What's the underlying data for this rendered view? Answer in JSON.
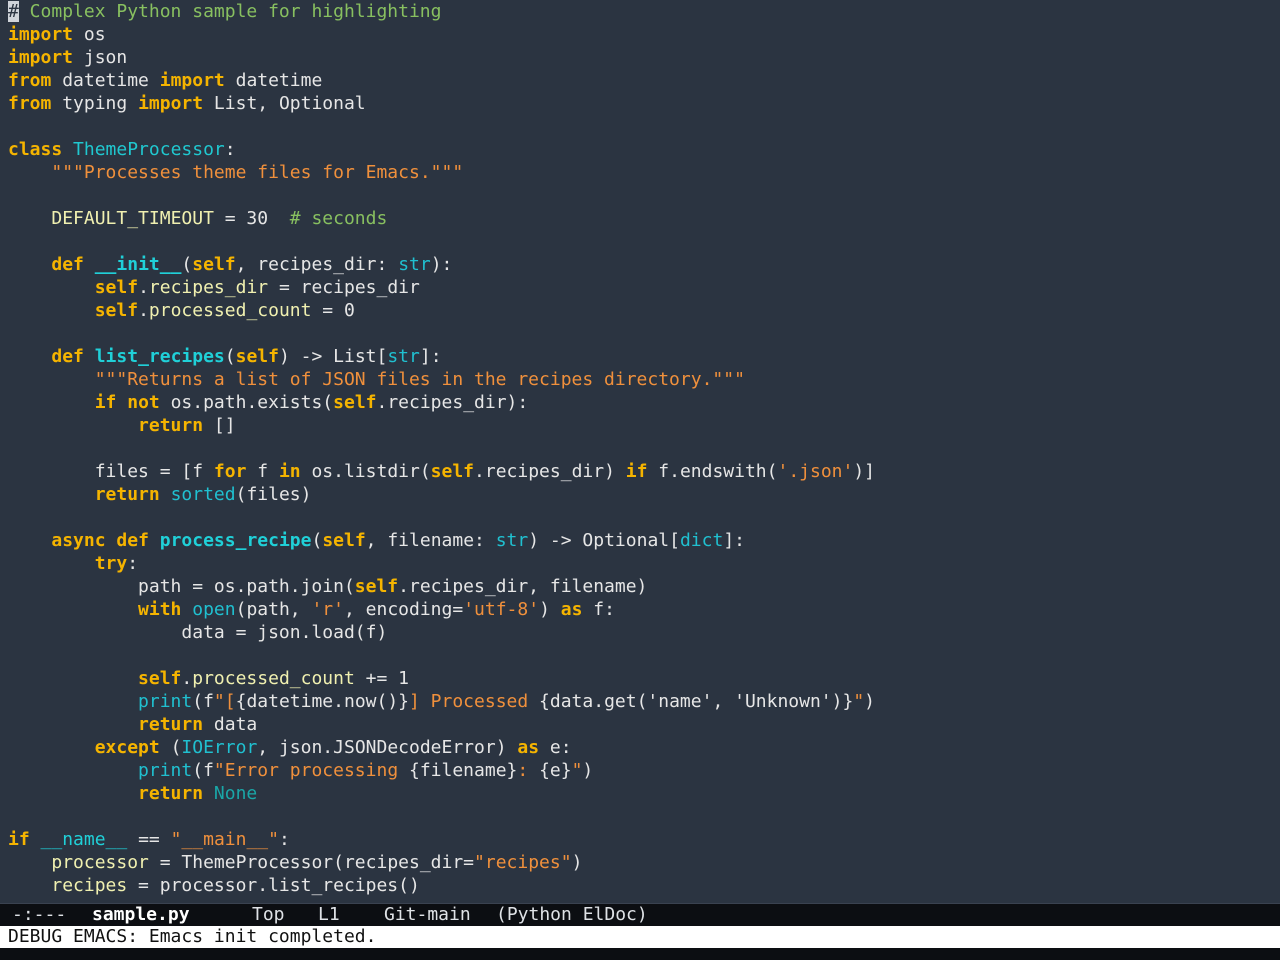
{
  "editor": {
    "lines": [
      [
        [
          "cursor",
          "#"
        ],
        [
          "cmt",
          " Complex Python sample for highlighting"
        ]
      ],
      [
        [
          "kw",
          "import"
        ],
        [
          "txt",
          " os"
        ]
      ],
      [
        [
          "kw",
          "import"
        ],
        [
          "txt",
          " json"
        ]
      ],
      [
        [
          "kw",
          "from"
        ],
        [
          "txt",
          " datetime "
        ],
        [
          "kw",
          "import"
        ],
        [
          "txt",
          " datetime"
        ]
      ],
      [
        [
          "kw",
          "from"
        ],
        [
          "txt",
          " typing "
        ],
        [
          "kw",
          "import"
        ],
        [
          "txt",
          " List, Optional"
        ]
      ],
      [],
      [
        [
          "kw",
          "class"
        ],
        [
          "txt",
          " "
        ],
        [
          "cls",
          "ThemeProcessor"
        ],
        [
          "txt",
          ":"
        ]
      ],
      [
        [
          "txt",
          "    "
        ],
        [
          "str",
          "\"\"\"Processes theme files for Emacs.\"\"\""
        ]
      ],
      [],
      [
        [
          "txt",
          "    "
        ],
        [
          "cst",
          "DEFAULT_TIMEOUT"
        ],
        [
          "txt",
          " = 30  "
        ],
        [
          "cmt",
          "# seconds"
        ]
      ],
      [],
      [
        [
          "txt",
          "    "
        ],
        [
          "kw",
          "def"
        ],
        [
          "txt",
          " "
        ],
        [
          "def",
          "__init__"
        ],
        [
          "txt",
          "("
        ],
        [
          "slf",
          "self"
        ],
        [
          "txt",
          ", recipes_dir: "
        ],
        [
          "blt",
          "str"
        ],
        [
          "txt",
          "):"
        ]
      ],
      [
        [
          "txt",
          "        "
        ],
        [
          "slf",
          "self"
        ],
        [
          "txt",
          "."
        ],
        [
          "prp",
          "recipes_dir"
        ],
        [
          "txt",
          " = recipes_dir"
        ]
      ],
      [
        [
          "txt",
          "        "
        ],
        [
          "slf",
          "self"
        ],
        [
          "txt",
          "."
        ],
        [
          "prp",
          "processed_count"
        ],
        [
          "txt",
          " = 0"
        ]
      ],
      [],
      [
        [
          "txt",
          "    "
        ],
        [
          "kw",
          "def"
        ],
        [
          "txt",
          " "
        ],
        [
          "def",
          "list_recipes"
        ],
        [
          "txt",
          "("
        ],
        [
          "slf",
          "self"
        ],
        [
          "txt",
          ") -> List["
        ],
        [
          "blt",
          "str"
        ],
        [
          "txt",
          "]:"
        ]
      ],
      [
        [
          "txt",
          "        "
        ],
        [
          "str",
          "\"\"\"Returns a list of JSON files in the recipes directory.\"\"\""
        ]
      ],
      [
        [
          "txt",
          "        "
        ],
        [
          "kw",
          "if"
        ],
        [
          "txt",
          " "
        ],
        [
          "kw",
          "not"
        ],
        [
          "txt",
          " os.path.exists("
        ],
        [
          "slf",
          "self"
        ],
        [
          "txt",
          ".recipes_dir):"
        ]
      ],
      [
        [
          "txt",
          "            "
        ],
        [
          "kw",
          "return"
        ],
        [
          "txt",
          " []"
        ]
      ],
      [],
      [
        [
          "txt",
          "        files = [f "
        ],
        [
          "kw",
          "for"
        ],
        [
          "txt",
          " f "
        ],
        [
          "kw",
          "in"
        ],
        [
          "txt",
          " os.listdir("
        ],
        [
          "slf",
          "self"
        ],
        [
          "txt",
          ".recipes_dir) "
        ],
        [
          "kw",
          "if"
        ],
        [
          "txt",
          " f.endswith("
        ],
        [
          "str",
          "'.json'"
        ],
        [
          "txt",
          ")]"
        ]
      ],
      [
        [
          "txt",
          "        "
        ],
        [
          "kw",
          "return"
        ],
        [
          "txt",
          " "
        ],
        [
          "blt",
          "sorted"
        ],
        [
          "txt",
          "(files)"
        ]
      ],
      [],
      [
        [
          "txt",
          "    "
        ],
        [
          "kw",
          "async"
        ],
        [
          "txt",
          " "
        ],
        [
          "kw",
          "def"
        ],
        [
          "txt",
          " "
        ],
        [
          "def",
          "process_recipe"
        ],
        [
          "txt",
          "("
        ],
        [
          "slf",
          "self"
        ],
        [
          "txt",
          ", filename: "
        ],
        [
          "blt",
          "str"
        ],
        [
          "txt",
          ") -> Optional["
        ],
        [
          "blt",
          "dict"
        ],
        [
          "txt",
          "]:"
        ]
      ],
      [
        [
          "txt",
          "        "
        ],
        [
          "kw",
          "try"
        ],
        [
          "txt",
          ":"
        ]
      ],
      [
        [
          "txt",
          "            path = os.path.join("
        ],
        [
          "slf",
          "self"
        ],
        [
          "txt",
          ".recipes_dir, filename)"
        ]
      ],
      [
        [
          "txt",
          "            "
        ],
        [
          "kw",
          "with"
        ],
        [
          "txt",
          " "
        ],
        [
          "blt",
          "open"
        ],
        [
          "txt",
          "(path, "
        ],
        [
          "str",
          "'r'"
        ],
        [
          "txt",
          ", encoding="
        ],
        [
          "str",
          "'utf-8'"
        ],
        [
          "txt",
          ") "
        ],
        [
          "kw",
          "as"
        ],
        [
          "txt",
          " f:"
        ]
      ],
      [
        [
          "txt",
          "                data = json.load(f)"
        ]
      ],
      [],
      [
        [
          "txt",
          "            "
        ],
        [
          "slf",
          "self"
        ],
        [
          "txt",
          "."
        ],
        [
          "prp",
          "processed_count"
        ],
        [
          "txt",
          " += 1"
        ]
      ],
      [
        [
          "txt",
          "            "
        ],
        [
          "blt",
          "print"
        ],
        [
          "txt",
          "(f"
        ],
        [
          "str",
          "\"["
        ],
        [
          "txt",
          "{datetime.now()}"
        ],
        [
          "str",
          "] Processed "
        ],
        [
          "txt",
          "{data.get('name', 'Unknown')}"
        ],
        [
          "str",
          "\""
        ],
        [
          "txt",
          ")"
        ]
      ],
      [
        [
          "txt",
          "            "
        ],
        [
          "kw",
          "return"
        ],
        [
          "txt",
          " data"
        ]
      ],
      [
        [
          "txt",
          "        "
        ],
        [
          "kw",
          "except"
        ],
        [
          "txt",
          " ("
        ],
        [
          "blt",
          "IOError"
        ],
        [
          "txt",
          ", json.JSONDecodeError) "
        ],
        [
          "kw",
          "as"
        ],
        [
          "txt",
          " e:"
        ]
      ],
      [
        [
          "txt",
          "            "
        ],
        [
          "blt",
          "print"
        ],
        [
          "txt",
          "(f"
        ],
        [
          "str",
          "\"Error processing "
        ],
        [
          "txt",
          "{filename}"
        ],
        [
          "str",
          ": "
        ],
        [
          "txt",
          "{e}"
        ],
        [
          "str",
          "\""
        ],
        [
          "txt",
          ")"
        ]
      ],
      [
        [
          "txt",
          "            "
        ],
        [
          "kw",
          "return"
        ],
        [
          "txt",
          " "
        ],
        [
          "non",
          "None"
        ]
      ],
      [],
      [
        [
          "kw",
          "if"
        ],
        [
          "txt",
          " "
        ],
        [
          "fn",
          "__name__"
        ],
        [
          "txt",
          " == "
        ],
        [
          "str",
          "\"__main__\""
        ],
        [
          "txt",
          ":"
        ]
      ],
      [
        [
          "txt",
          "    "
        ],
        [
          "cst",
          "processor"
        ],
        [
          "txt",
          " = ThemeProcessor(recipes_dir="
        ],
        [
          "str",
          "\"recipes\""
        ],
        [
          "txt",
          ")"
        ]
      ],
      [
        [
          "txt",
          "    "
        ],
        [
          "cst",
          "recipes"
        ],
        [
          "txt",
          " = processor.list_recipes()"
        ]
      ]
    ]
  },
  "modeline": {
    "status": "-:---",
    "buffer_name": "sample.py",
    "position": "Top",
    "line": "L1",
    "vc": "Git-main",
    "modes": "(Python ElDoc)"
  },
  "minibuffer": {
    "message": "DEBUG EMACS: Emacs init completed."
  }
}
